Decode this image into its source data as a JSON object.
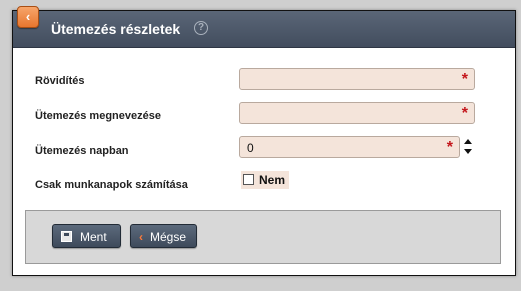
{
  "dialog": {
    "title": "Ütemezés részletek",
    "help_icon": "question-circle-icon",
    "back_icon": "chevron-left-icon"
  },
  "form": {
    "fields": [
      {
        "label": "Rövidítés",
        "value": "",
        "required": true
      },
      {
        "label": "Ütemezés megnevezése",
        "value": "",
        "required": true
      },
      {
        "label": "Ütemezés napban",
        "value": "0",
        "required": true
      }
    ],
    "required_marker": "*",
    "checkbox": {
      "label": "Csak munkanapok számítása",
      "option_label": "Nem",
      "checked": false
    }
  },
  "footer": {
    "save_label": "Ment",
    "cancel_label": "Mégse",
    "save_icon": "floppy-disk-icon",
    "cancel_icon": "chevron-left-icon"
  },
  "colors": {
    "titlebar": "#4b5668",
    "back_button": "#e7762e",
    "input_bg": "#f4e4da",
    "required": "#c4161c",
    "button": "#4a5668"
  }
}
